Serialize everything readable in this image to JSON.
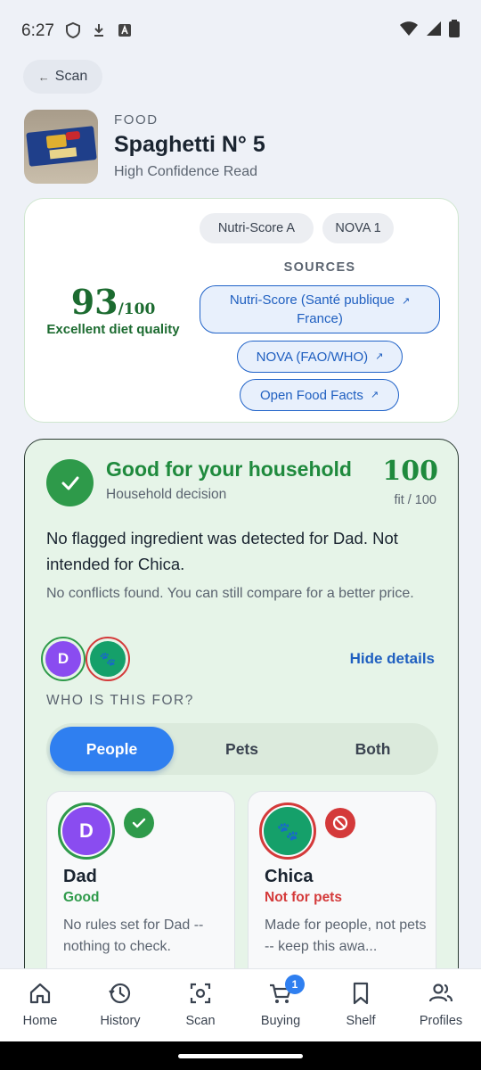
{
  "status_bar": {
    "time": "6:27"
  },
  "back": {
    "label": "Scan",
    "arrow": "←"
  },
  "product": {
    "category": "FOOD",
    "title": "Spaghetti N° 5",
    "subtitle": "High Confidence Read"
  },
  "score_card": {
    "chips": [
      "Nutri-Score A",
      "NOVA 1"
    ],
    "score": "93",
    "score_max": "/100",
    "score_label": "Excellent diet quality",
    "sources_label": "SOURCES",
    "sources": [
      {
        "label_line1": "Nutri-Score (Santé publique",
        "label_line2": "France)"
      },
      {
        "label": "NOVA (FAO/WHO)"
      },
      {
        "label": "Open Food Facts"
      }
    ],
    "external_icon": "↗"
  },
  "household": {
    "title": "Good for your household",
    "subtitle": "Household decision",
    "fit_score": "100",
    "fit_label": "fit / 100",
    "message": "No flagged ingredient was detected for Dad. Not intended for Chica.",
    "note": "No conflicts found. You can still compare for a better price.",
    "avatars": [
      {
        "initial": "D",
        "color": "#8a4cf0",
        "ring": "#2e9a4a"
      },
      {
        "glyph": "🐾",
        "color": "#15a06a",
        "ring": "#d43a3a"
      }
    ],
    "hide_details": "Hide details",
    "who_label": "WHO IS THIS FOR?",
    "segments": [
      "People",
      "Pets",
      "Both"
    ],
    "active_segment": "People",
    "members": [
      {
        "initial": "D",
        "name": "Dad",
        "status": "Good",
        "status_color": "#2e9a4a",
        "desc": "No rules set for Dad -- nothing to check."
      },
      {
        "glyph": "🐾",
        "name": "Chica",
        "status": "Not for pets",
        "status_color": "#d43a3a",
        "desc": "Made for people, not pets -- keep this awa..."
      }
    ]
  },
  "nav": {
    "items": [
      {
        "label": "Home",
        "icon": "home-icon"
      },
      {
        "label": "History",
        "icon": "history-icon"
      },
      {
        "label": "Scan",
        "icon": "scan-icon"
      },
      {
        "label": "Buying",
        "icon": "cart-icon",
        "badge": "1"
      },
      {
        "label": "Shelf",
        "icon": "bookmark-icon"
      },
      {
        "label": "Profiles",
        "icon": "profiles-icon"
      }
    ]
  },
  "colors": {
    "accent_blue": "#2f7ff0",
    "good_green": "#2e9a4a",
    "alert_red": "#d43a3a",
    "card_green_bg": "#e6f4e8"
  }
}
